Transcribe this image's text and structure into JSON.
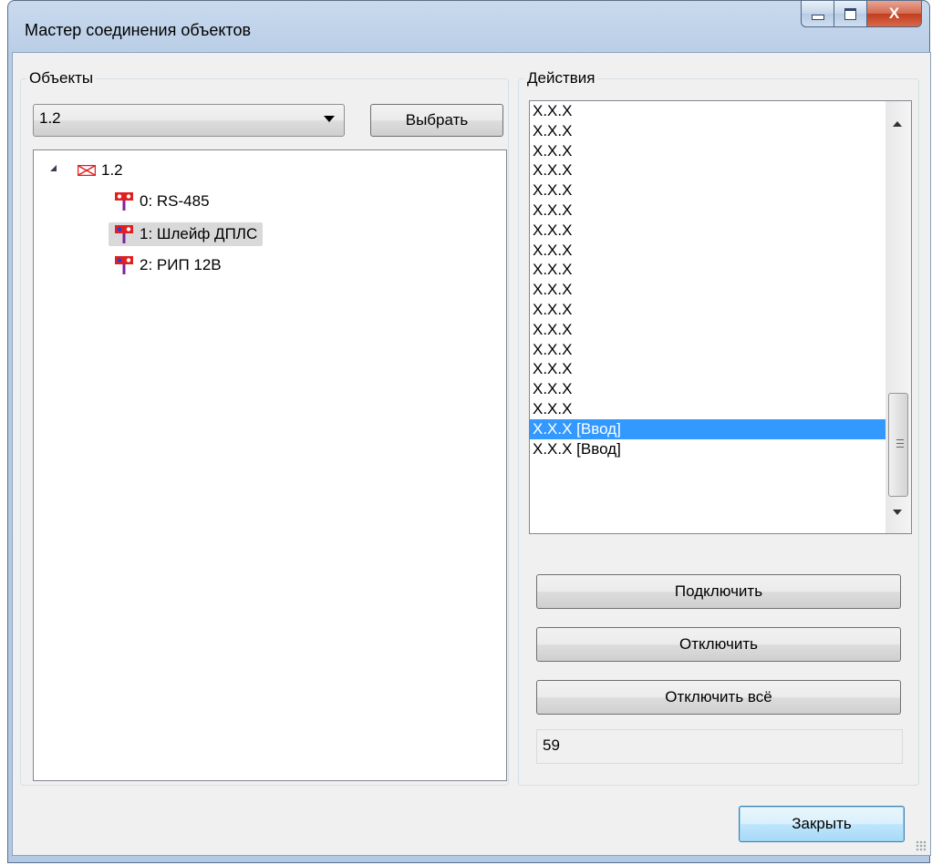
{
  "window": {
    "title": "Мастер соединения объектов",
    "close_glyph": "X"
  },
  "objects": {
    "group_title": "Объекты",
    "selected": "1.2",
    "choose_label": "Выбрать",
    "tree": {
      "root": "1.2",
      "children": [
        "0: RS-485",
        "1: Шлейф ДПЛС",
        "2: РИП 12В"
      ],
      "selected_index": 1
    }
  },
  "actions": {
    "group_title": "Действия",
    "items": [
      "X.X.X",
      "X.X.X",
      "X.X.X",
      "X.X.X",
      "X.X.X",
      "X.X.X",
      "X.X.X",
      "X.X.X",
      "X.X.X",
      "X.X.X",
      "X.X.X",
      "X.X.X",
      "X.X.X",
      "X.X.X",
      "X.X.X",
      "X.X.X",
      "X.X.X [Ввод]",
      "X.X.X [Ввод]"
    ],
    "selected_index": 16,
    "connect_label": "Подключить",
    "disconnect_label": "Отключить",
    "disconnect_all_label": "Отключить всё",
    "count": "59"
  },
  "footer": {
    "close_label": "Закрыть"
  },
  "colors": {
    "selection": "#3399ff",
    "icon_red": "#e02020",
    "icon_blue": "#2040e0",
    "icon_purple": "#8020a0"
  }
}
